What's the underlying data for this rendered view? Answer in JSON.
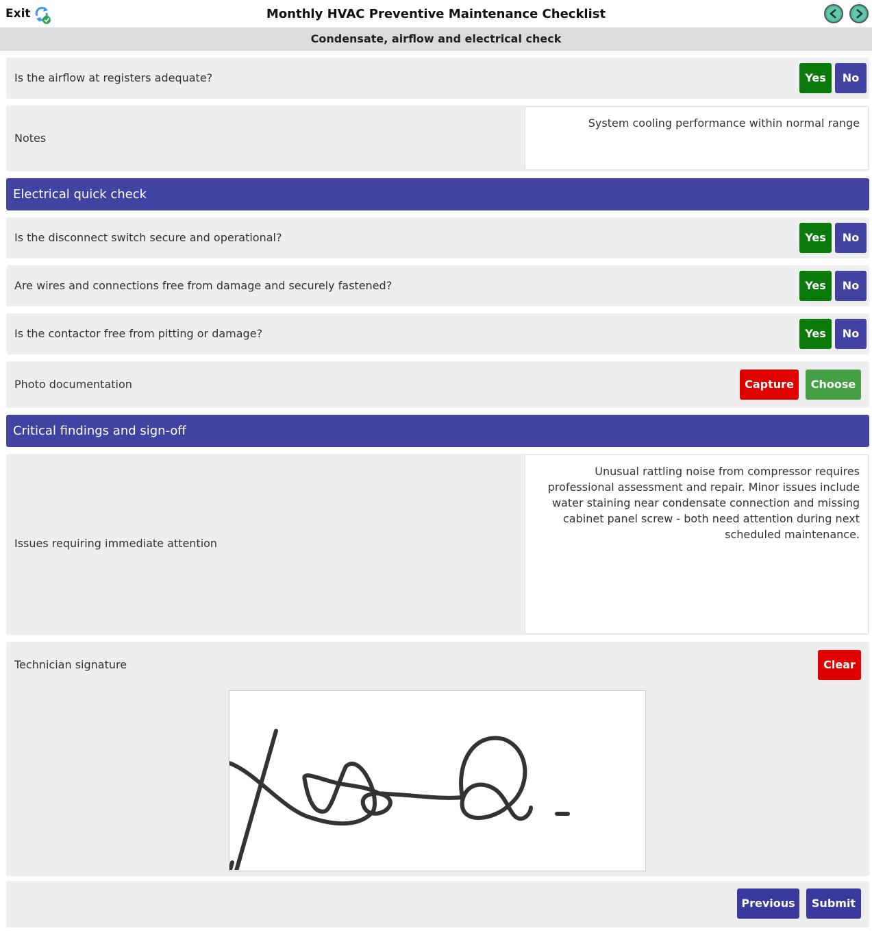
{
  "header": {
    "exit_label": "Exit",
    "title": "Monthly HVAC Preventive Maintenance Checklist",
    "subtitle": "Condensate, airflow and electrical check"
  },
  "questions": {
    "airflow": "Is the airflow at registers adequate?",
    "disconnect": "Is the disconnect switch secure and operational?",
    "wires": "Are wires and connections free from damage and securely fastened?",
    "contactor": "Is the contactor free from pitting or damage?"
  },
  "buttons": {
    "yes": "Yes",
    "no": "No",
    "capture": "Capture",
    "choose": "Choose",
    "clear": "Clear",
    "previous": "Previous",
    "submit": "Submit"
  },
  "notes": {
    "label": "Notes",
    "value": "System cooling performance within normal range"
  },
  "sections": {
    "electrical": "Electrical quick check",
    "critical": "Critical findings and sign-off"
  },
  "photo": {
    "label": "Photo documentation"
  },
  "issues": {
    "label": "Issues requiring immediate attention",
    "value": "Unusual rattling noise from compressor requires professional assessment and repair. Minor issues include water staining near condensate connection and missing cabinet panel screw - both need attention during next scheduled maintenance."
  },
  "signature": {
    "label": "Technician signature"
  },
  "colors": {
    "yes": "#0a7a0a",
    "no": "#4242a3",
    "section_header": "#4242a3",
    "danger": "#e00000",
    "choose": "#45a045",
    "row_bg": "#eeeeee"
  }
}
